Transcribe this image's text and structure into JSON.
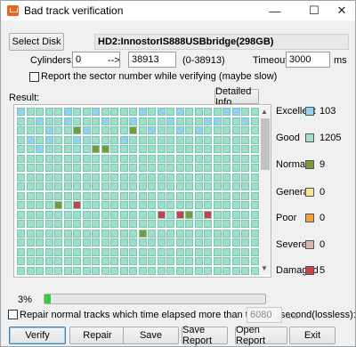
{
  "window": {
    "title": "Bad track verification",
    "minimize": "—",
    "maximize": "☐",
    "close": "✕"
  },
  "disk": {
    "select_button": "Select Disk",
    "name": "HD2:InnostorIS888USBbridge(298GB)"
  },
  "cylinders": {
    "label": "Cylinders:",
    "from": "0",
    "arrow": "-->",
    "to": "38913",
    "range": "(0-38913)"
  },
  "timeout": {
    "label": "Timeout:",
    "value": "3000",
    "unit": "ms"
  },
  "report_sector_label": "Report the sector number while verifying (maybe slow)",
  "result_label": "Result:",
  "detailed_info_button": "Detailed Info",
  "legend": [
    {
      "label": "Excellent",
      "count": "103",
      "color": "#8fd3f0"
    },
    {
      "label": "Good",
      "count": "1205",
      "color": "#9ddfc8"
    },
    {
      "label": "Normal",
      "count": "9",
      "color": "#7a9a3a"
    },
    {
      "label": "General",
      "count": "0",
      "color": "#f5e69a"
    },
    {
      "label": "Poor",
      "count": "0",
      "color": "#f2a23a"
    },
    {
      "label": "Severe",
      "count": "0",
      "color": "#d8b8a8"
    },
    {
      "label": "Damaged",
      "count": "5",
      "color": "#c8414a"
    }
  ],
  "grid": {
    "cols": 27,
    "rows": 18,
    "excellent_cells": [
      [
        0,
        0
      ],
      [
        0,
        5
      ],
      [
        0,
        8
      ],
      [
        0,
        13
      ],
      [
        0,
        15
      ],
      [
        0,
        17
      ],
      [
        0,
        22
      ],
      [
        0,
        23
      ],
      [
        1,
        2
      ],
      [
        1,
        5
      ],
      [
        1,
        9
      ],
      [
        1,
        12
      ],
      [
        1,
        16
      ],
      [
        1,
        20
      ],
      [
        1,
        21
      ],
      [
        1,
        24
      ],
      [
        2,
        3
      ],
      [
        2,
        7
      ],
      [
        2,
        14
      ],
      [
        2,
        17
      ],
      [
        2,
        19
      ],
      [
        3,
        1
      ],
      [
        3,
        3
      ],
      [
        3,
        6
      ],
      [
        3,
        11
      ],
      [
        4,
        2
      ]
    ],
    "normal_cells": [
      [
        2,
        6
      ],
      [
        2,
        12
      ],
      [
        4,
        8
      ],
      [
        4,
        9
      ],
      [
        10,
        4
      ],
      [
        11,
        18
      ],
      [
        13,
        13
      ]
    ],
    "damaged_cells": [
      [
        10,
        6
      ],
      [
        11,
        15
      ],
      [
        11,
        17
      ],
      [
        11,
        20
      ]
    ]
  },
  "progress": {
    "label": "3%",
    "value_fraction": 0.03
  },
  "repair_option": {
    "label": "Repair normal tracks which time elapsed more than this millisecond(lossless):",
    "value": "6080",
    "unit": "ms"
  },
  "buttons": {
    "verify": "Verify",
    "repair": "Repair",
    "save": "Save",
    "save_report": "Save Report",
    "open_report": "Open Report",
    "exit": "Exit"
  }
}
